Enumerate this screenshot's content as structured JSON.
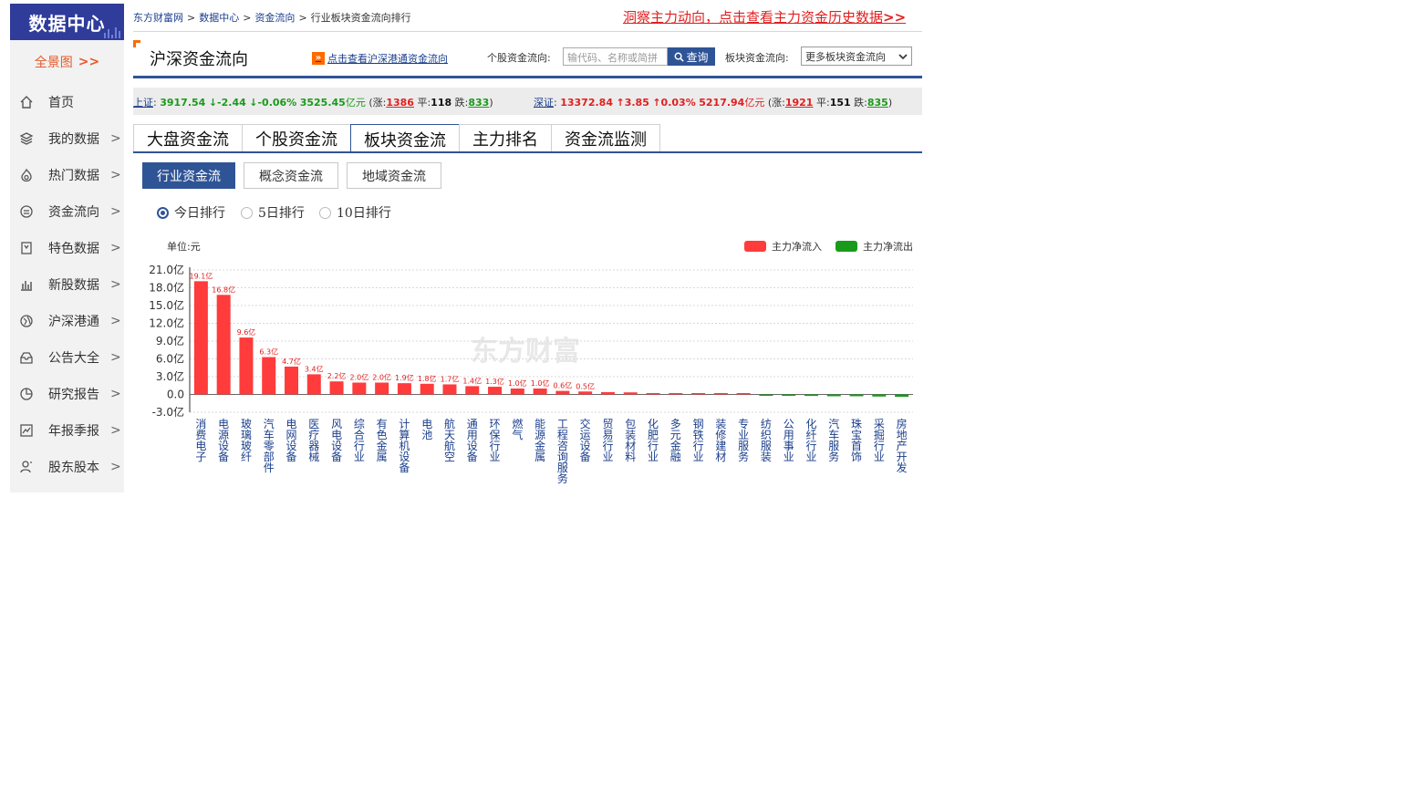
{
  "sidebar": {
    "logo": "数据中心",
    "overview": "全景图",
    "overview_arrow": ">>",
    "items": [
      {
        "label": "首页",
        "icon": "home-icon",
        "chevron": ""
      },
      {
        "label": "我的数据",
        "icon": "layers-icon",
        "chevron": ">"
      },
      {
        "label": "热门数据",
        "icon": "flame-icon",
        "chevron": ">"
      },
      {
        "label": "资金流向",
        "icon": "money-flow-icon",
        "chevron": ">"
      },
      {
        "label": "特色数据",
        "icon": "bookmark-icon",
        "chevron": ">"
      },
      {
        "label": "新股数据",
        "icon": "bar-chart-icon",
        "chevron": ">"
      },
      {
        "label": "沪深港通",
        "icon": "globe-icon",
        "chevron": ">"
      },
      {
        "label": "公告大全",
        "icon": "inbox-icon",
        "chevron": ">"
      },
      {
        "label": "研究报告",
        "icon": "pie-chart-icon",
        "chevron": ">"
      },
      {
        "label": "年报季报",
        "icon": "line-chart-icon",
        "chevron": ">"
      },
      {
        "label": "股东股本",
        "icon": "user-icon",
        "chevron": ">"
      }
    ]
  },
  "breadcrumb": {
    "items": [
      "东方财富网",
      "数据中心",
      "资金流向"
    ],
    "current": "行业板块资金流向排行",
    "sep": ">"
  },
  "promo": {
    "text": "洞察主力动向，点击查看主力资金历史数据",
    "arrow": ">>"
  },
  "header": {
    "title": "沪深资金流向",
    "hk_badge": "»",
    "hk_link": "点击查看沪深港通资金流向",
    "stock_label": "个股资金流向:",
    "search_placeholder": "输代码、名称或简拼",
    "search_button": "查询",
    "sector_label": "板块资金流向:",
    "sector_select": "更多板块资金流向"
  },
  "index_bar": {
    "sh": {
      "name": "上证",
      "price": "3917.54",
      "change": "↓-2.44",
      "pct": "↓-0.06%",
      "amount": "3525.45",
      "unit": "亿元",
      "up_label": "(涨:",
      "up": "1386",
      "flat_label": "平:",
      "flat": "118",
      "down_label": "跌:",
      "down": "833",
      "close": ")"
    },
    "sz": {
      "name": "深证",
      "price": "13372.84",
      "change": "↑3.85",
      "pct": "↑0.03%",
      "amount": "5217.94",
      "unit": "亿元",
      "up_label": "(涨:",
      "up": "1921",
      "flat_label": "平:",
      "flat": "151",
      "down_label": "跌:",
      "down": "835",
      "close": ")"
    },
    "colon": ":"
  },
  "tabs": [
    "大盘资金流",
    "个股资金流",
    "板块资金流",
    "主力排名",
    "资金流监测"
  ],
  "active_tab": 2,
  "subtabs": [
    "行业资金流",
    "概念资金流",
    "地域资金流"
  ],
  "active_subtab": 0,
  "radios": [
    "今日排行",
    "5日排行",
    "10日排行"
  ],
  "active_radio": 0,
  "chart_data": {
    "type": "bar",
    "unit_label": "单位:元",
    "watermark": "东方财富",
    "legend": [
      {
        "name": "主力净流入",
        "color": "#ff3b3b"
      },
      {
        "name": "主力净流出",
        "color": "#1a9a1a"
      }
    ],
    "y_ticks": [
      "21.0亿",
      "18.0亿",
      "15.0亿",
      "12.0亿",
      "9.0亿",
      "6.0亿",
      "3.0亿",
      "0.0",
      "-3.0亿"
    ],
    "ylim": [
      -3,
      21
    ],
    "grid": true,
    "categories": [
      "消费电子",
      "电源设备",
      "玻璃玻纤",
      "汽车零部件",
      "电网设备",
      "医疗器械",
      "风电设备",
      "综合行业",
      "有色金属",
      "计算机设备",
      "电池",
      "航天航空",
      "通用设备",
      "环保行业",
      "燃气",
      "能源金属",
      "工程咨询服务",
      "交运设备",
      "贸易行业",
      "包装材料",
      "化肥行业",
      "多元金融",
      "钢铁行业",
      "装修建材",
      "专业服务",
      "纺织服装",
      "公用事业",
      "化纤行业",
      "汽车服务",
      "珠宝首饰",
      "采掘行业",
      "房地产开发"
    ],
    "values": [
      19.1,
      16.8,
      9.6,
      6.3,
      4.7,
      3.4,
      2.2,
      2.0,
      2.0,
      1.9,
      1.8,
      1.7,
      1.4,
      1.3,
      1.0,
      1.0,
      0.6,
      0.5,
      0.4,
      0.35,
      0.2,
      0.1,
      0.05,
      0.05,
      0.03,
      -0.15,
      -0.2,
      -0.25,
      -0.3,
      -0.3,
      -0.35,
      -0.4
    ],
    "data_labels": [
      "19.1亿",
      "16.8亿",
      "9.6亿",
      "6.3亿",
      "4.7亿",
      "3.4亿",
      "2.2亿",
      "2.0亿",
      "2.0亿",
      "1.9亿",
      "1.8亿",
      "1.7亿",
      "1.4亿",
      "1.3亿",
      "1.0亿",
      "1.0亿",
      "0.6亿",
      "0.5亿"
    ]
  },
  "colors": {
    "brand": "#2f3c9a",
    "accent": "#2f5496",
    "up": "#ff3b3b",
    "down": "#1a9a1a",
    "orange": "#e55a2b"
  }
}
